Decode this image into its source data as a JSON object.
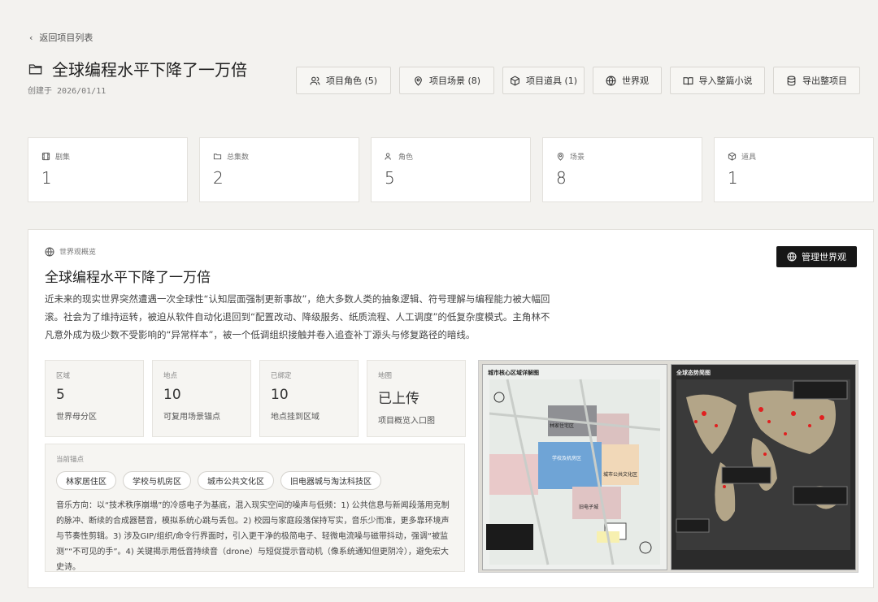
{
  "nav": {
    "back_label": "返回项目列表"
  },
  "project": {
    "title": "全球编程水平下降了一万倍",
    "created_prefix": "创建于",
    "created_date": "2026/01/11"
  },
  "toolbar": [
    {
      "name": "roles-button",
      "icon": "users-icon",
      "label": "项目角色 (5)"
    },
    {
      "name": "scenes-button",
      "icon": "map-pin-icon",
      "label": "项目场景 (8)"
    },
    {
      "name": "props-button",
      "icon": "cube-icon",
      "label": "项目道具 (1)"
    },
    {
      "name": "worldview-button",
      "icon": "globe-icon",
      "label": "世界观"
    },
    {
      "name": "import-novel-button",
      "icon": "book-icon",
      "label": "导入整篇小说"
    },
    {
      "name": "export-project-button",
      "icon": "database-icon",
      "label": "导出整项目"
    }
  ],
  "stats": [
    {
      "name": "stat-episodes",
      "icon": "film-icon",
      "label": "剧集",
      "value": "1"
    },
    {
      "name": "stat-total-episodes",
      "icon": "folder-icon",
      "label": "总集数",
      "value": "2"
    },
    {
      "name": "stat-roles",
      "icon": "users-icon",
      "label": "角色",
      "value": "5"
    },
    {
      "name": "stat-scenes",
      "icon": "map-pin-icon",
      "label": "场景",
      "value": "8"
    },
    {
      "name": "stat-props",
      "icon": "cube-icon",
      "label": "道具",
      "value": "1"
    }
  ],
  "world": {
    "header": "世界观概览",
    "title": "全球编程水平下降了一万倍",
    "manage_label": "管理世界观",
    "description": "近未来的现实世界突然遭遇一次全球性“认知层面强制更新事故”，绝大多数人类的抽象逻辑、符号理解与编程能力被大幅回滚。社会为了维持运转，被迫从软件自动化退回到“配置改动、降级服务、纸质流程、人工调度”的低复杂度模式。主角林不凡意外成为极少数不受影响的“异常样本”，被一个低调组织接触并卷入追查补丁源头与修复路径的暗线。",
    "minis": [
      {
        "label": "区域",
        "value": "5",
        "sub": "世界母分区"
      },
      {
        "label": "地点",
        "value": "10",
        "sub": "可复用场景锚点"
      },
      {
        "label": "已绑定",
        "value": "10",
        "sub": "地点挂到区域"
      },
      {
        "label": "地图",
        "value": "已上传",
        "sub": "项目概览入口图"
      }
    ],
    "current_label": "当前锚点",
    "tags": [
      "林家居住区",
      "学校与机房区",
      "城市公共文化区",
      "旧电器城与淘汰科技区"
    ],
    "music": "音乐方向：以“技术秩序崩塌”的冷感电子为基底，混入现实空间的噪声与低频：1) 公共信息与新闻段落用克制的脉冲、断续的合成器琶音，模拟系统心跳与丢包。2) 校园与家庭段落保持写实，音乐少而准，更多靠环境声与节奏性剪辑。3) 涉及GIP/组织/命令行界面时，引入更干净的极简电子、轻微电流噪与磁带抖动，强调“被监测”“不可见的手”。4) 关键揭示用低音持续音（drone）与短促提示音动机（像系统通知但更阴冷），避免宏大史诗。",
    "map_left_title": "城市核心区域详解图",
    "map_right_title": "全球态势简图",
    "map_labels": [
      "林家住宅区",
      "学校及机房区",
      "城市公共文化区",
      "旧电子城"
    ]
  },
  "colors": {
    "accent": "#161616",
    "bg": "#f3f2ef",
    "alert": "#e02020"
  }
}
